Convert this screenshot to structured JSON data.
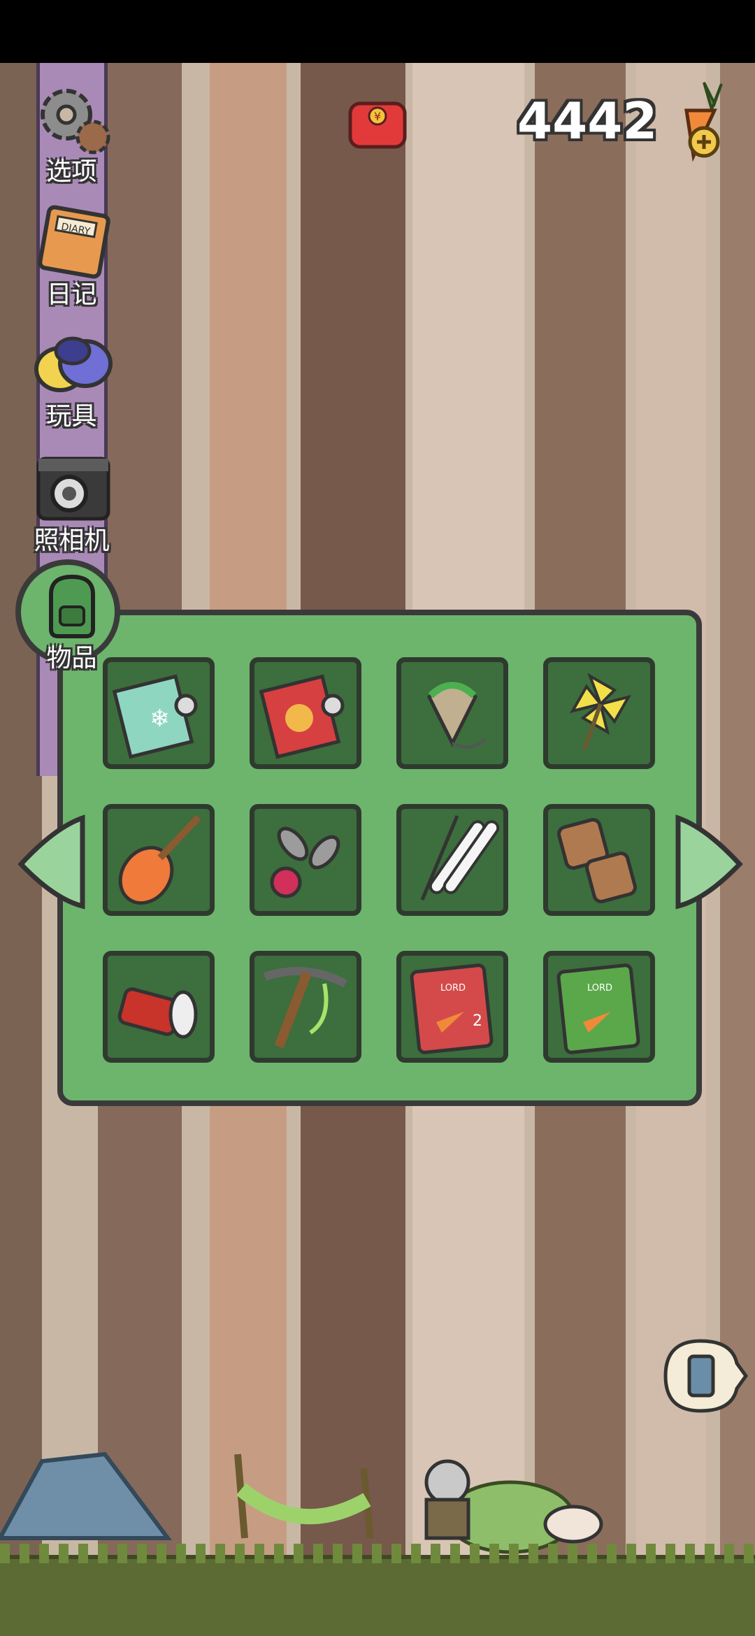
{
  "hud": {
    "carrot_count": "4442",
    "gift_icon": "red-envelope-icon",
    "add_carrots_icon": "carrot-plus-icon"
  },
  "menu": {
    "items": [
      {
        "label": "选项",
        "icon": "gear-icon"
      },
      {
        "label": "日记",
        "icon": "diary-icon"
      },
      {
        "label": "玩具",
        "icon": "toys-icon"
      },
      {
        "label": "照相机",
        "icon": "camera-icon"
      },
      {
        "label": "物品",
        "icon": "backpack-icon"
      }
    ]
  },
  "inventory": {
    "items": [
      {
        "icon": "snowflake-wrapping-paper-icon"
      },
      {
        "icon": "flower-wrapping-paper-icon"
      },
      {
        "icon": "spinning-top-icon"
      },
      {
        "icon": "pinwheel-icon"
      },
      {
        "icon": "lute-icon"
      },
      {
        "icon": "juggling-pins-icon"
      },
      {
        "icon": "skis-icon"
      },
      {
        "icon": "geta-sandals-icon"
      },
      {
        "icon": "flashlight-icon"
      },
      {
        "icon": "pickaxe-icon"
      },
      {
        "icon": "lord-of-the-carrots-book-2-icon"
      },
      {
        "icon": "lord-of-the-carrots-book-icon"
      }
    ]
  },
  "colors": {
    "panel_green": "#6db46d",
    "slot_green": "#3d6e3d",
    "sidebar_purple": "#a98ab6"
  }
}
